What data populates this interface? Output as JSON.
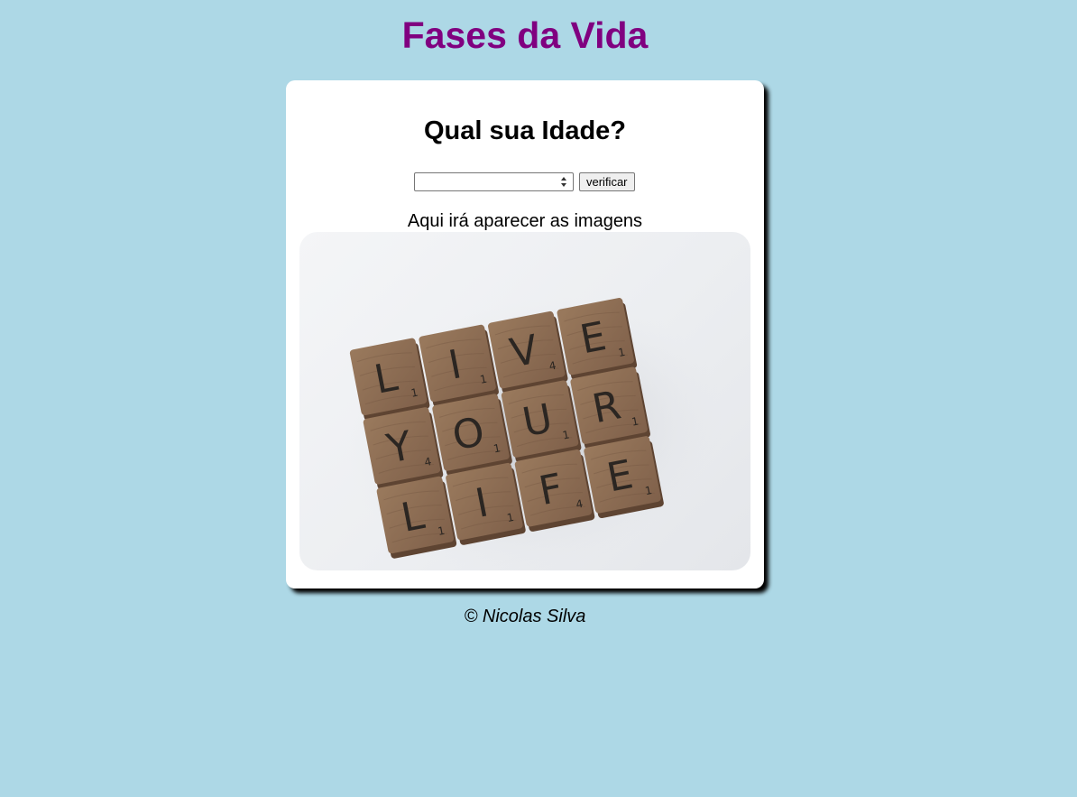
{
  "header": {
    "title": "Fases da Vida"
  },
  "card": {
    "question": "Qual sua Idade?",
    "age_select": {
      "selected_value": ""
    },
    "verify_button_label": "verificar",
    "result_text": "Aqui irá aparecer as imagens",
    "image": {
      "tiles": [
        {
          "letter": "L",
          "points": "1"
        },
        {
          "letter": "I",
          "points": "1"
        },
        {
          "letter": "V",
          "points": "4"
        },
        {
          "letter": "E",
          "points": "1"
        },
        {
          "letter": "Y",
          "points": "4"
        },
        {
          "letter": "O",
          "points": "1"
        },
        {
          "letter": "U",
          "points": "1"
        },
        {
          "letter": "R",
          "points": "1"
        },
        {
          "letter": "L",
          "points": "1"
        },
        {
          "letter": "I",
          "points": "1"
        },
        {
          "letter": "F",
          "points": "4"
        },
        {
          "letter": "E",
          "points": "1"
        }
      ]
    }
  },
  "footer": {
    "text": "© Nicolas Silva"
  },
  "colors": {
    "background": "#add8e6",
    "title": "#800080",
    "card": "#ffffff",
    "tile_wood": "#8a6a4f"
  }
}
